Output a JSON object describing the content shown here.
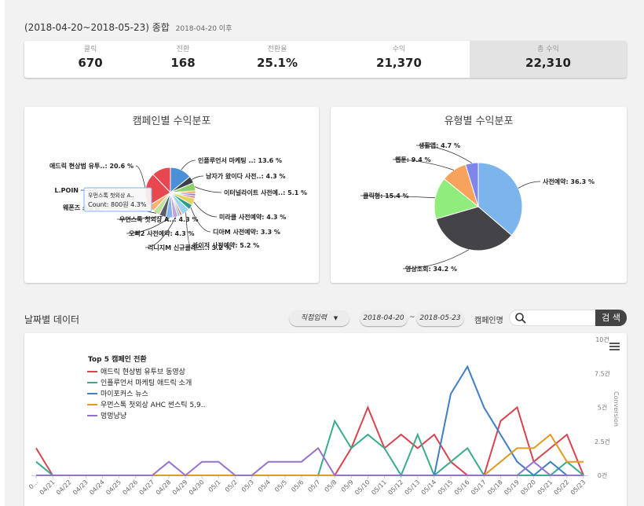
{
  "header": {
    "title": "(2018-04-20~2018-05-23) 종합",
    "subtitle": "2018-04-20 이후"
  },
  "stats": [
    {
      "label": "클릭",
      "value": "670"
    },
    {
      "label": "전환",
      "value": "168"
    },
    {
      "label": "전환율",
      "value": "25.1%"
    },
    {
      "label": "수익",
      "value": "21,370"
    },
    {
      "label": "총 수익",
      "value": "22,310"
    }
  ],
  "colors": {
    "campaign_line_1": "#d9434f",
    "campaign_line_2": "#3aab8d",
    "campaign_line_3": "#3f7ec4",
    "campaign_line_4": "#e09a1e",
    "campaign_line_5": "#9473cf",
    "accent_dark": "#444444"
  },
  "pie_campaign": {
    "title": "캠페인별 수익분포",
    "slices": [
      {
        "name": "인플루언서 마케팅 ..",
        "value": 13.6,
        "label": "인플루언서 마케팅 ..: 13.6 %",
        "color": "#4a90d9"
      },
      {
        "name": "남자가 왔어다 사전..",
        "value": 4.3,
        "label": "남자가 왔이다 사전..: 4.3 %",
        "color": "#3a3f48"
      },
      {
        "name": "이터널라이트 사전예..",
        "value": 5.1,
        "label": "이터널라이트 사전예..: 5.1 %",
        "color": "#8fcf6a"
      },
      {
        "name": "s4",
        "value": 1.6,
        "color": "#f6a04d"
      },
      {
        "name": "s5",
        "value": 1.6,
        "color": "#8a7ed6"
      },
      {
        "name": "s6",
        "value": 1.5,
        "color": "#f26b8a"
      },
      {
        "name": "미라클 사전예약",
        "value": 4.3,
        "label": "미라클 사전예약: 4.3 %",
        "color": "#e4d35a"
      },
      {
        "name": "디아M 사전예약",
        "value": 3.3,
        "label": "디아M 사전예약: 3.3 %",
        "color": "#2a9d8f"
      },
      {
        "name": "카이저 사전예약",
        "value": 5.2,
        "label": "카이저 사전예약: 5.2 %",
        "color": "#9fd3f0"
      },
      {
        "name": "s10",
        "value": 1.4,
        "color": "#f06b5e"
      },
      {
        "name": "s11",
        "value": 1.4,
        "color": "#66cccc"
      },
      {
        "name": "리니지M 신규클래스..",
        "value": 3.2,
        "label": "리니지M 신규클래스..: 3.2 %",
        "color": "#c9a0dc"
      },
      {
        "name": "오빠2 사전예약",
        "value": 4.3,
        "label": "오빠2 사전예약: 4.3 %",
        "color": "#7fb5ef"
      },
      {
        "name": "우먼스톡 첫외상 A..",
        "value": 4.3,
        "label": "우먼스톡 첫외상 A..: 4.3 %",
        "color": "#5a5f6a"
      },
      {
        "name": "웨폰즈 소울걸",
        "value": 4.3,
        "label": "웨폰즈 소울걸 ",
        "color": "#bfe39d"
      },
      {
        "name": "L.POINT",
        "value": 4.3,
        "label": "L.POIN",
        "color": "#ffb36b"
      },
      {
        "name": "애드릭 현상범 유투..",
        "value": 20.6,
        "label": "애드릭 현상범 유투..: 20.6 %",
        "color": "#e8474f"
      },
      {
        "name": "s18",
        "value": 11.7,
        "color": "#e8474f"
      }
    ],
    "tooltip": {
      "title": "우먼스톡 첫외상 A..",
      "line": "Count: 800원 4.3%"
    }
  },
  "pie_type": {
    "title": "유형별 수익분포",
    "slices": [
      {
        "name": "사전예약",
        "value": 36.3,
        "label": "사전예약: 36.3 %",
        "color": "#7cb5ec"
      },
      {
        "name": "영상조회",
        "value": 34.2,
        "label": "영상조회: 34.2 %",
        "color": "#434348"
      },
      {
        "name": "클릭형",
        "value": 15.4,
        "label": "클릭형: 15.4 %",
        "color": "#90ed7d"
      },
      {
        "name": "웹툰",
        "value": 9.4,
        "label": "웹툰: 9.4 %",
        "color": "#f7a35c"
      },
      {
        "name": "생활앱",
        "value": 4.7,
        "label": "생활앱: 4.7 %",
        "color": "#8085e9"
      }
    ]
  },
  "daily": {
    "title": "날짜별 데이터",
    "mode_label": "직접입력",
    "start_date": "2018-04-20",
    "end_date": "2018-05-23",
    "tilde": "~",
    "campaign_label": "캠페인명",
    "search_placeholder": "",
    "search_button": "검 색"
  },
  "chart_data": {
    "type": "line",
    "title": "",
    "legend_title": "Top 5 캠페인 전환",
    "ylabel": "Conversion",
    "ylim": [
      0,
      10
    ],
    "yticks": [
      "0건",
      "2.5건",
      "5건",
      "7.5건",
      "10건"
    ],
    "categories": [
      "04/20",
      "04/21",
      "04/22",
      "04/23",
      "04/24",
      "04/25",
      "04/26",
      "04/27",
      "04/28",
      "04/29",
      "04/30",
      "05/1",
      "05/2",
      "05/3",
      "05/4",
      "05/5",
      "05/6",
      "05/7",
      "05/8",
      "05/9",
      "05/10",
      "05/11",
      "05/12",
      "05/13",
      "05/14",
      "05/15",
      "05/16",
      "05/17",
      "05/18",
      "05/19",
      "05/20",
      "05/21",
      "05/22",
      "05/23"
    ],
    "x_labels": [
      "0...",
      "04/21",
      "04/22",
      "04/23",
      "04/24",
      "04/25",
      "04/26",
      "04/27",
      "04/28",
      "04/29",
      "04/30",
      "05/1",
      "05/2",
      "05/3",
      "05/4",
      "05/5",
      "05/6",
      "05/7",
      "05/8",
      "05/9",
      "05/10",
      "05/11",
      "05/12",
      "05/13",
      "05/14",
      "05/15",
      "05/16",
      "05/17",
      "05/18",
      "05/19",
      "05/20",
      "05/21",
      "05/22",
      "05/23"
    ],
    "series": [
      {
        "name": "애드릭 현상범 유투브 동영상",
        "values": [
          2,
          0,
          0,
          0,
          0,
          0,
          0,
          0,
          0,
          0,
          0,
          0,
          0,
          0,
          0,
          0,
          0,
          0,
          0,
          2,
          5,
          2,
          3,
          2,
          3,
          1,
          0,
          0,
          4,
          5,
          1,
          2,
          3,
          0
        ]
      },
      {
        "name": "인플루언서 마케팅 애드릭 소개",
        "values": [
          1,
          0,
          0,
          0,
          0,
          0,
          0,
          0,
          0,
          0,
          0,
          0,
          0,
          0,
          0,
          0,
          0,
          0,
          4,
          2,
          3,
          2,
          0,
          3,
          0,
          1,
          2,
          0,
          0,
          0,
          0,
          0,
          1,
          0
        ]
      },
      {
        "name": "마이포커스 뉴스",
        "values": [
          0,
          0,
          0,
          0,
          0,
          0,
          0,
          0,
          0,
          0,
          0,
          0,
          0,
          0,
          0,
          0,
          0,
          0,
          0,
          0,
          0,
          0,
          0,
          0,
          0,
          6,
          8,
          5,
          3,
          1,
          0,
          1,
          0,
          0
        ]
      },
      {
        "name": "우먼스톡 첫외상 AHC 썬스틱 5,9..",
        "values": [
          0,
          0,
          0,
          0,
          0,
          0,
          0,
          0,
          0,
          0,
          0,
          0,
          0,
          0,
          0,
          0,
          0,
          0,
          0,
          0,
          0,
          0,
          0,
          0,
          0,
          0,
          0,
          0,
          1,
          2,
          2,
          3,
          1,
          1
        ]
      },
      {
        "name": "멍멍냥냥",
        "values": [
          0,
          0,
          0,
          0,
          0,
          0,
          0,
          0,
          1,
          0,
          1,
          1,
          0,
          0,
          1,
          1,
          1,
          2,
          0,
          0,
          0,
          0,
          0,
          0,
          0,
          0,
          0,
          0,
          0,
          0,
          1,
          0,
          0,
          0
        ]
      }
    ]
  }
}
